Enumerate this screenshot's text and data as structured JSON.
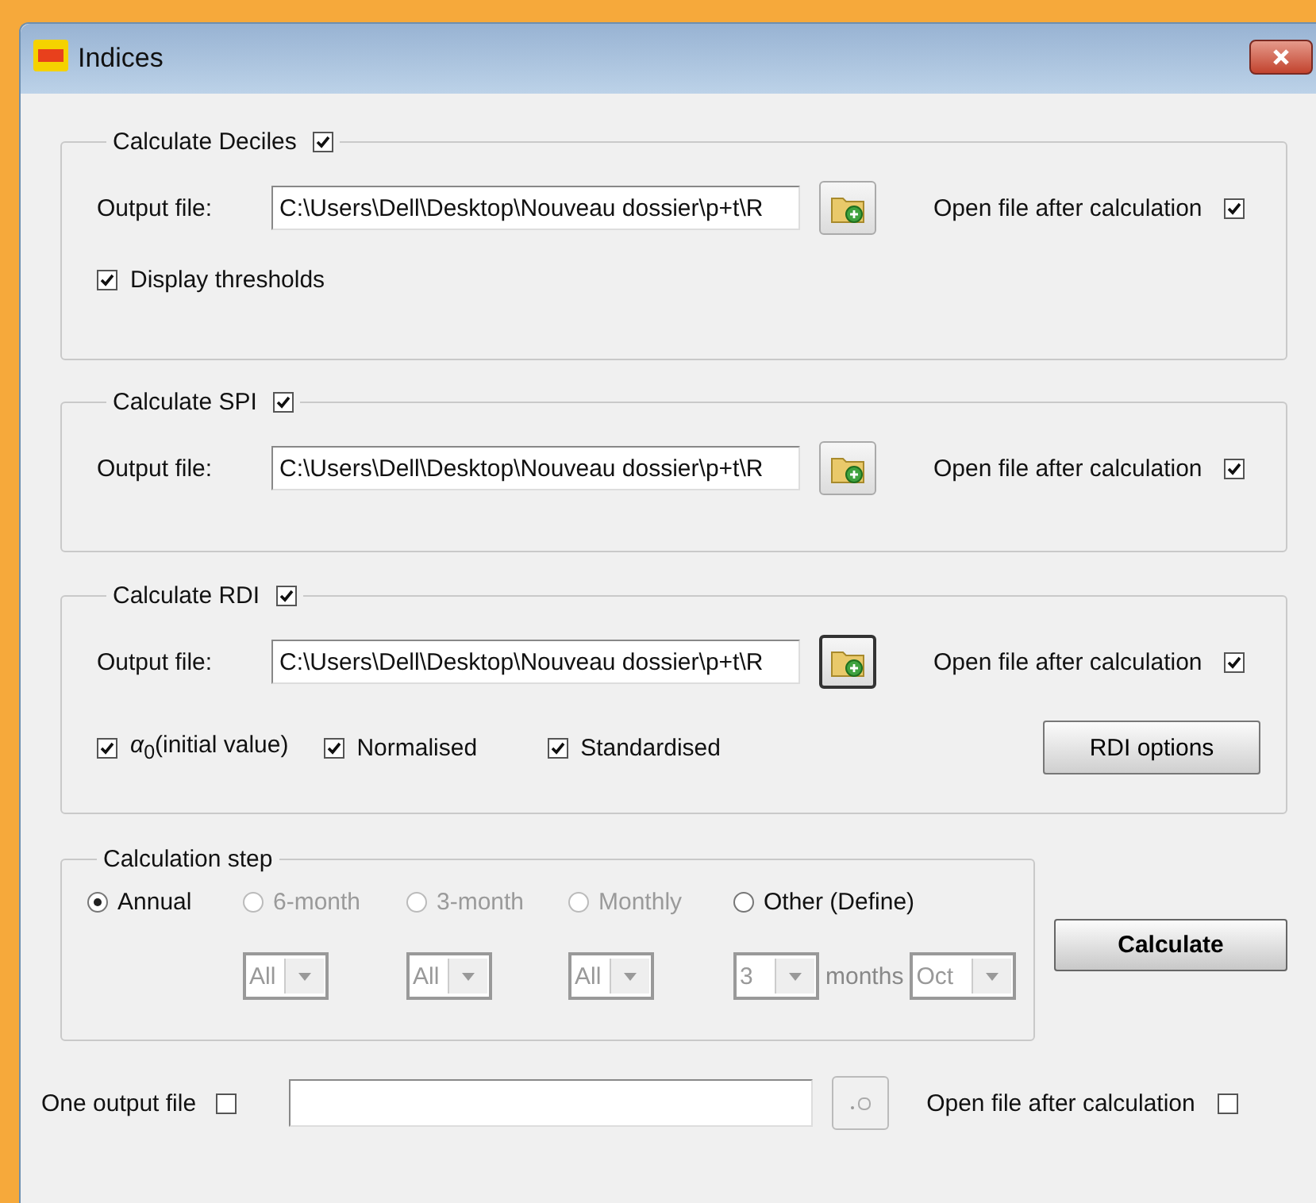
{
  "window": {
    "title": "Indices"
  },
  "sections": [
    {
      "title": "Calculate Deciles",
      "checked": true,
      "output_label": "Output file:",
      "path": "C:\\Users\\Dell\\Desktop\\Nouveau dossier\\p+t\\R",
      "focused": false,
      "open_label": "Open file after calculation",
      "open_checked": true,
      "options": [
        {
          "label": "Display thresholds",
          "checked": true
        }
      ]
    },
    {
      "title": "Calculate SPI",
      "checked": true,
      "output_label": "Output file:",
      "path": "C:\\Users\\Dell\\Desktop\\Nouveau dossier\\p+t\\R",
      "focused": false,
      "open_label": "Open file after calculation",
      "open_checked": true
    },
    {
      "title": "Calculate RDI",
      "checked": true,
      "output_label": "Output file:",
      "path": "C:\\Users\\Dell\\Desktop\\Nouveau dossier\\p+t\\R",
      "focused": true,
      "open_label": "Open file after calculation",
      "open_checked": true,
      "options": [
        {
          "label": "*α*$_{0}$(initial value)",
          "checked": true
        },
        {
          "label": "Normalised",
          "checked": true
        },
        {
          "label": "Standardised",
          "checked": true
        }
      ],
      "button": {
        "label": "RDI options"
      }
    }
  ],
  "calculation_step": {
    "title": "Calculation step",
    "options": [
      {
        "label": "Annual",
        "selected": true,
        "disabled": false
      },
      {
        "label": "6-month",
        "selected": false,
        "disabled": true,
        "dropdowns": [
          {
            "value": "All",
            "disabled": true
          }
        ]
      },
      {
        "label": "3-month",
        "selected": false,
        "disabled": true,
        "dropdowns": [
          {
            "value": "All",
            "disabled": true
          }
        ]
      },
      {
        "label": "Monthly",
        "selected": false,
        "disabled": true,
        "dropdowns": [
          {
            "value": "All",
            "disabled": true
          }
        ]
      },
      {
        "label": "Other (Define)",
        "selected": false,
        "disabled": false,
        "dropdowns": [
          {
            "value": "3",
            "disabled": true,
            "unit": "months"
          },
          {
            "value": "Oct",
            "disabled": true
          }
        ]
      }
    ]
  },
  "calculate_button": {
    "label": "Calculate"
  },
  "single_output": {
    "label": "One output file",
    "checked": false,
    "browse_disabled": true,
    "open_label": "Open file after calculation",
    "open_checked": false
  }
}
